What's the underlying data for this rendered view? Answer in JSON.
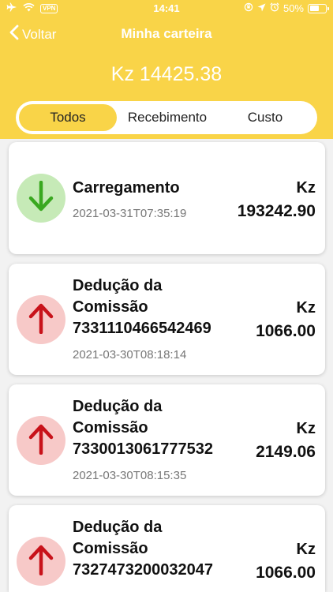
{
  "status": {
    "time": "14:41",
    "vpn": "VPN",
    "battery": "50%"
  },
  "nav": {
    "back_label": "Voltar",
    "title": "Minha carteira"
  },
  "balance": "Kz 14425.38",
  "tabs": [
    {
      "label": "Todos",
      "active": true
    },
    {
      "label": "Recebimento",
      "active": false
    },
    {
      "label": "Custo",
      "active": false
    }
  ],
  "transactions": [
    {
      "direction": "in",
      "title": "Carregamento",
      "date": "2021-03-31T07:35:19",
      "currency": "Kz",
      "amount": "193242.90"
    },
    {
      "direction": "out",
      "title_line1": "Dedução da",
      "title_line2": "Comissão",
      "title_line3": "7331110466542469",
      "date": "2021-03-30T08:18:14",
      "currency": "Kz",
      "amount": "1066.00"
    },
    {
      "direction": "out",
      "title_line1": "Dedução da",
      "title_line2": "Comissão",
      "title_line3": "7330013061777532",
      "date": "2021-03-30T08:15:35",
      "currency": "Kz",
      "amount": "2149.06"
    },
    {
      "direction": "out",
      "title_line1": "Dedução da",
      "title_line2": "Comissão",
      "title_line3": "7327473200032047",
      "date": "",
      "currency": "Kz",
      "amount": "1066.00"
    }
  ],
  "colors": {
    "brand_yellow": "#f9d448",
    "income": "#3aa820",
    "expense": "#c8121a"
  }
}
